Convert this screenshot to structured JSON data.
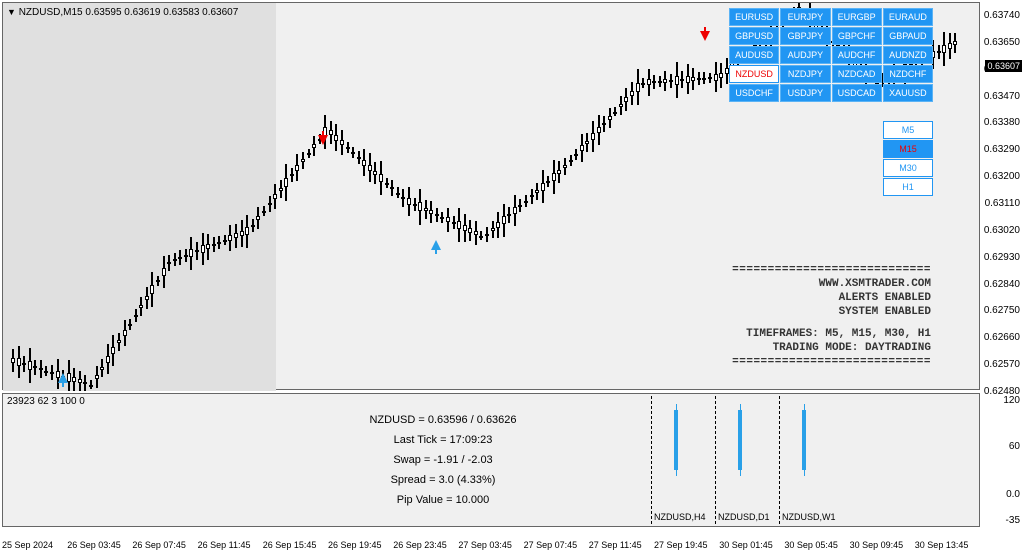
{
  "chart": {
    "title": "NZDUSD,M15  0.63595 0.63619 0.63583 0.63607",
    "current_price": "0.63607",
    "y_ticks": [
      "0.63740",
      "0.63650",
      "0.63560",
      "0.63470",
      "0.63380",
      "0.63290",
      "0.63200",
      "0.63110",
      "0.63020",
      "0.62930",
      "0.62840",
      "0.62750",
      "0.62660",
      "0.62570",
      "0.62480"
    ],
    "x_ticks": [
      "25 Sep 2024",
      "26 Sep 03:45",
      "26 Sep 07:45",
      "26 Sep 11:45",
      "26 Sep 15:45",
      "26 Sep 19:45",
      "26 Sep 23:45",
      "27 Sep 03:45",
      "27 Sep 07:45",
      "27 Sep 11:45",
      "27 Sep 19:45",
      "30 Sep 01:45",
      "30 Sep 05:45",
      "30 Sep 09:45",
      "30 Sep 13:45"
    ]
  },
  "chart_data": {
    "type": "candlestick",
    "symbol": "NZDUSD",
    "timeframe": "M15",
    "ohlc_last": {
      "open": 0.63595,
      "high": 0.63619,
      "low": 0.63583,
      "close": 0.63607
    },
    "x_range": [
      "25 Sep 2024 00:00",
      "30 Sep 2024 14:00"
    ],
    "y_range": [
      0.6248,
      0.6374
    ],
    "signals": [
      {
        "type": "buy",
        "time": "25 Sep 21:30",
        "price": 0.625
      },
      {
        "type": "sell",
        "time": "26 Sep 17:45",
        "price": 0.6339
      },
      {
        "type": "buy",
        "time": "27 Sep 06:45",
        "price": 0.6298
      },
      {
        "type": "sell",
        "time": "30 Sep 05:30",
        "price": 0.637
      }
    ],
    "approx_price_path": [
      {
        "t": "25 Sep 00:00",
        "p": 0.6258
      },
      {
        "t": "25 Sep 22:00",
        "p": 0.625
      },
      {
        "t": "26 Sep 04:00",
        "p": 0.629
      },
      {
        "t": "26 Sep 08:00",
        "p": 0.63
      },
      {
        "t": "26 Sep 15:00",
        "p": 0.6333
      },
      {
        "t": "26 Sep 22:00",
        "p": 0.631
      },
      {
        "t": "27 Sep 06:00",
        "p": 0.6298
      },
      {
        "t": "27 Sep 11:00",
        "p": 0.632
      },
      {
        "t": "27 Sep 16:00",
        "p": 0.6348
      },
      {
        "t": "30 Sep 01:00",
        "p": 0.635
      },
      {
        "t": "30 Sep 05:30",
        "p": 0.6372
      },
      {
        "t": "30 Sep 09:00",
        "p": 0.6348
      },
      {
        "t": "30 Sep 13:45",
        "p": 0.6361
      }
    ]
  },
  "symbol_panel": {
    "rows": [
      [
        "EURUSD",
        "EURJPY",
        "EURGBP",
        "EURAUD"
      ],
      [
        "GBPUSD",
        "GBPJPY",
        "GBPCHF",
        "GBPAUD"
      ],
      [
        "AUDUSD",
        "AUDJPY",
        "AUDCHF",
        "AUDNZD"
      ],
      [
        "NZDUSD",
        "NZDJPY",
        "NZDCAD",
        "NZDCHF"
      ],
      [
        "USDCHF",
        "USDJPY",
        "USDCAD",
        "XAUUSD"
      ]
    ],
    "active": "NZDUSD"
  },
  "tf_panel": {
    "items": [
      "M5",
      "M15",
      "M30",
      "H1"
    ],
    "active": "M15"
  },
  "info_panel": {
    "dash": "============================",
    "site": "WWW.XSMTRADER.COM",
    "alerts": "ALERTS ENABLED",
    "system": "SYSTEM ENABLED",
    "timeframes": "TIMEFRAMES: M5, M15, M30, H1",
    "mode": "TRADING MODE: DAYTRADING"
  },
  "bottom": {
    "title": "23923 62 3 100 0",
    "line1": "NZDUSD = 0.63596 / 0.63626",
    "line2": "Last Tick = 17:09:23",
    "line3": "Swap = -1.91 / -2.03",
    "line4": "Spread = 3.0  (4.33%)",
    "line5": "Pip Value = 10.000",
    "mini": [
      "NZDUSD,H4",
      "NZDUSD,D1",
      "NZDUSD,W1"
    ],
    "y_ticks": [
      "120",
      "60",
      "0.0",
      "-35"
    ]
  }
}
